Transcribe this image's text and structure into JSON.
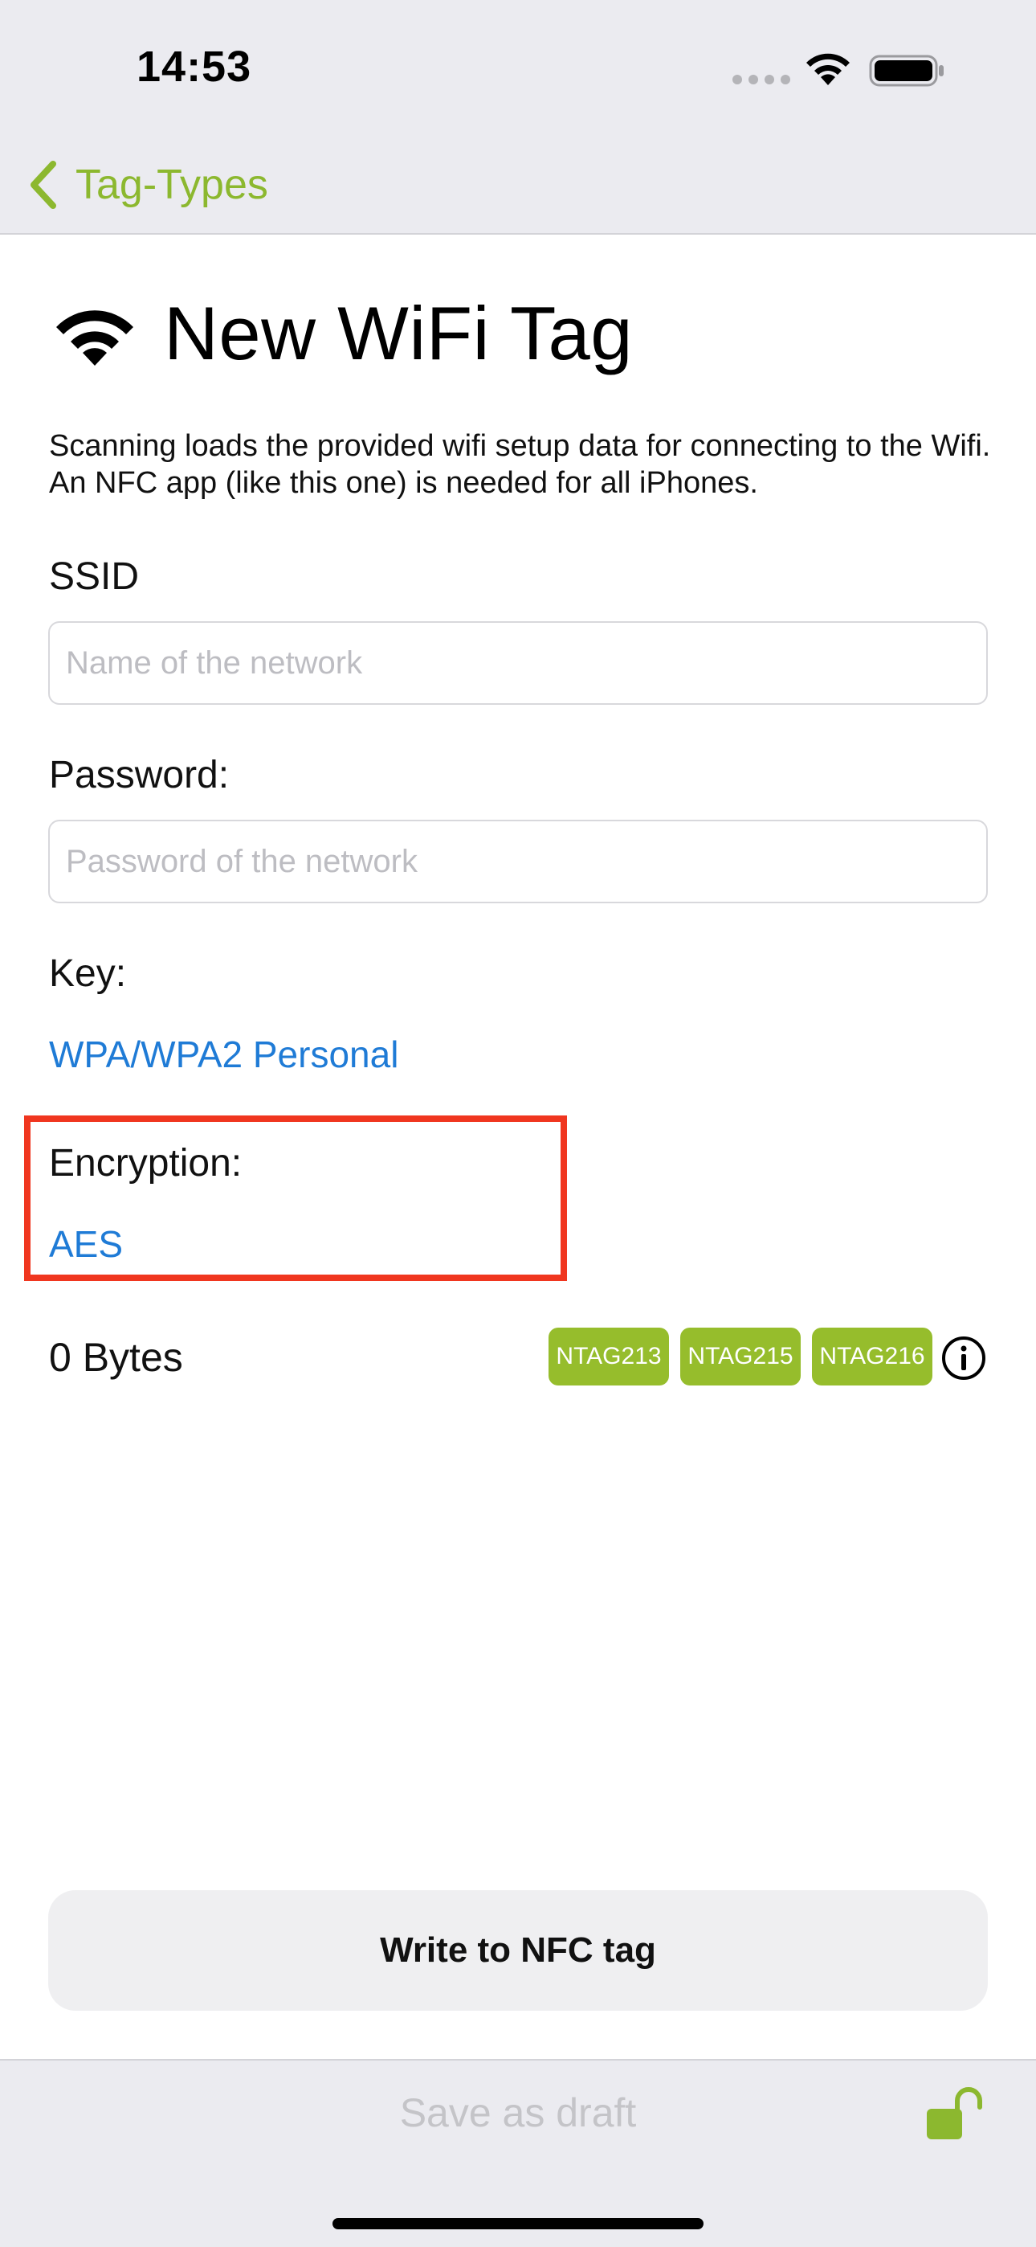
{
  "status_bar": {
    "time": "14:53",
    "wifi_icon": "wifi-icon",
    "battery_icon": "battery-icon"
  },
  "nav": {
    "back_label": "Tag-Types",
    "accent_color": "#8cb82f"
  },
  "page": {
    "title": "New WiFi Tag",
    "title_icon": "wifi-icon",
    "description": "Scanning loads the provided wifi setup data for connecting to the Wifi. An NFC app (like this one) is needed for all iPhones."
  },
  "form": {
    "ssid": {
      "label": "SSID",
      "value": "",
      "placeholder": "Name of the network"
    },
    "password": {
      "label": "Password:",
      "value": "",
      "placeholder": "Password of the network"
    },
    "key": {
      "label": "Key:",
      "value": "WPA/WPA2 Personal"
    },
    "encryption": {
      "label": "Encryption:",
      "value": "AES"
    }
  },
  "tag_info": {
    "bytes": "0 Bytes",
    "chips": [
      "NTAG213",
      "NTAG215",
      "NTAG216"
    ],
    "chip_color": "#96bd2c"
  },
  "actions": {
    "write_label": "Write to NFC tag",
    "draft_label": "Save as draft"
  },
  "colors": {
    "link": "#1f7bd6",
    "highlight": "#f0361f"
  }
}
